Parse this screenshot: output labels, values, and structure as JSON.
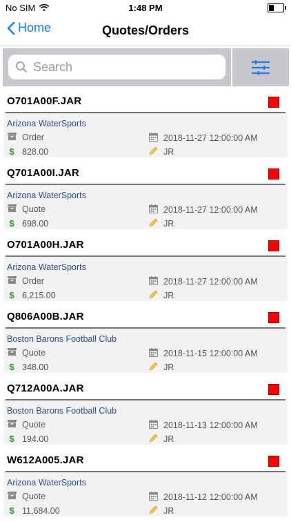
{
  "status_bar": {
    "carrier": "No SIM",
    "time": "1:48 PM",
    "battery_level": 0.35
  },
  "nav": {
    "back_label": "Home",
    "title": "Quotes/Orders"
  },
  "search": {
    "placeholder": "Search"
  },
  "colors": {
    "accent": "#1a7cf4",
    "status_red": "#ff0000",
    "customer_link": "#2b4f8a",
    "amount_icon": "#2a9d2a"
  },
  "orders": [
    {
      "number": "O701A00F.JAR",
      "customer": "Arizona WaterSports",
      "type": "Order",
      "date": "2018-11-27 12:00:00 AM",
      "amount": "828.00",
      "user": "JR"
    },
    {
      "number": "Q701A00I.JAR",
      "customer": "Arizona WaterSports",
      "type": "Quote",
      "date": "2018-11-27 12:00:00 AM",
      "amount": "698.00",
      "user": "JR"
    },
    {
      "number": "O701A00H.JAR",
      "customer": "Arizona WaterSports",
      "type": "Order",
      "date": "2018-11-27 12:00:00 AM",
      "amount": "6,215.00",
      "user": "JR"
    },
    {
      "number": "Q806A00B.JAR",
      "customer": "Boston Barons Football Club",
      "type": "Quote",
      "date": "2018-11-15 12:00:00 AM",
      "amount": "348.00",
      "user": "JR"
    },
    {
      "number": "Q712A00A.JAR",
      "customer": "Boston Barons Football Club",
      "type": "Quote",
      "date": "2018-11-13 12:00:00 AM",
      "amount": "194.00",
      "user": "JR"
    },
    {
      "number": "W612A005.JAR",
      "customer": "Arizona WaterSports",
      "type": "Quote",
      "date": "2018-11-12 12:00:00 AM",
      "amount": "11,684.00",
      "user": "JR"
    }
  ]
}
